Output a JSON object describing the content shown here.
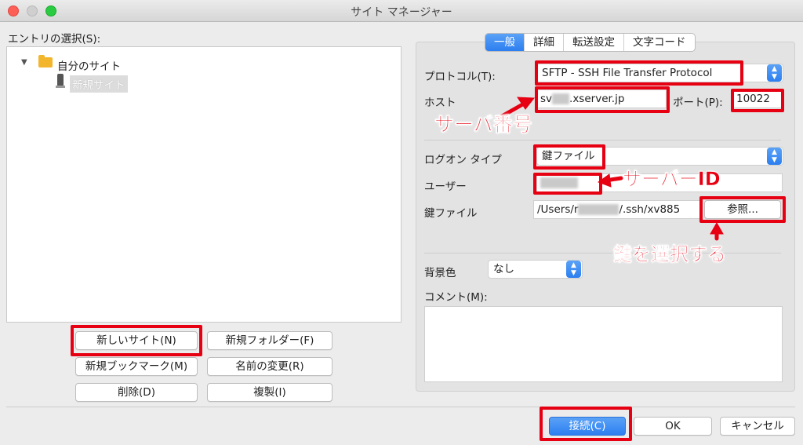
{
  "window": {
    "title": "サイト マネージャー"
  },
  "left": {
    "entry_label": "エントリの選択(S):",
    "tree": {
      "folder": "自分のサイト",
      "site": "新規サイト"
    },
    "buttons": {
      "new_site": "新しいサイト(N)",
      "new_folder": "新規フォルダー(F)",
      "new_bookmark": "新規ブックマーク(M)",
      "rename": "名前の変更(R)",
      "delete": "削除(D)",
      "duplicate": "複製(I)"
    }
  },
  "tabs": [
    "一般",
    "詳細",
    "転送設定",
    "文字コード"
  ],
  "form": {
    "protocol_label": "プロトコル(T):",
    "protocol_value": "SFTP - SSH File Transfer Protocol",
    "host_label": "ホスト",
    "host_prefix": "sv",
    "host_suffix": ".xserver.jp",
    "port_label": "ポート(P):",
    "port_value": "10022",
    "logon_label": "ログオン タイプ",
    "logon_value": "鍵ファイル",
    "user_label": "ユーザー",
    "keyfile_label": "鍵ファイル",
    "keyfile_prefix": "/Users/r",
    "keyfile_suffix": "/.ssh/xv885",
    "browse_button": "参照...",
    "bgcolor_label": "背景色",
    "bgcolor_value": "なし",
    "comment_label": "コメント(M):"
  },
  "footer": {
    "connect": "接続(C)",
    "ok": "OK",
    "cancel": "キャンセル"
  },
  "annotations": {
    "server_number": "サーバ番号",
    "server_id": "サーバーID",
    "select_key": "鍵を選択する"
  },
  "colors": {
    "annotation": "#e60012",
    "accent": "#2d7ff0"
  }
}
